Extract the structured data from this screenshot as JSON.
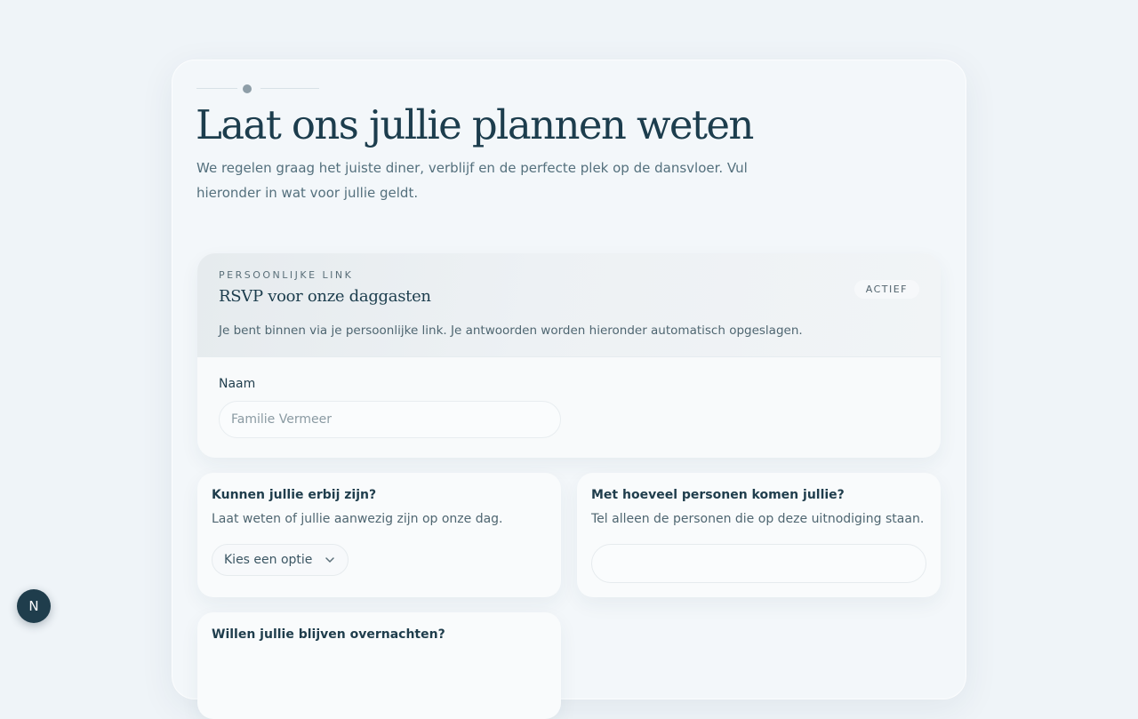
{
  "header": {
    "title": "Laat ons jullie plannen weten",
    "intro": "We regelen graag het juiste diner, verblijf en de perfecte plek op de dansvloer. Vul hieronder in wat voor jullie geldt."
  },
  "link_card": {
    "eyebrow": "PERSOONLIJKE LINK",
    "title": "RSVP voor onze daggasten",
    "status": "ACTIEF",
    "note": "Je bent binnen via je persoonlijke link. Je antwoorden worden hieronder automatisch opgeslagen.",
    "name_label": "Naam",
    "name_placeholder": "Familie Vermeer"
  },
  "questions": {
    "attend": {
      "title": "Kunnen jullie erbij zijn?",
      "description": "Laat weten of jullie aanwezig zijn op onze dag.",
      "select_value": "Kies een optie"
    },
    "count": {
      "title": "Met hoeveel personen komen jullie?",
      "description": "Tel alleen de personen die op deze uitnodiging staan.",
      "value": ""
    },
    "stay": {
      "title": "Willen jullie blijven overnachten?"
    }
  },
  "dev_badge": {
    "letter": "N"
  },
  "icons": {
    "select": "chevron-down-icon"
  },
  "colors": {
    "background": "#eff4f8",
    "text_primary": "#1f3d4c",
    "badge": "#1f3d4c"
  }
}
